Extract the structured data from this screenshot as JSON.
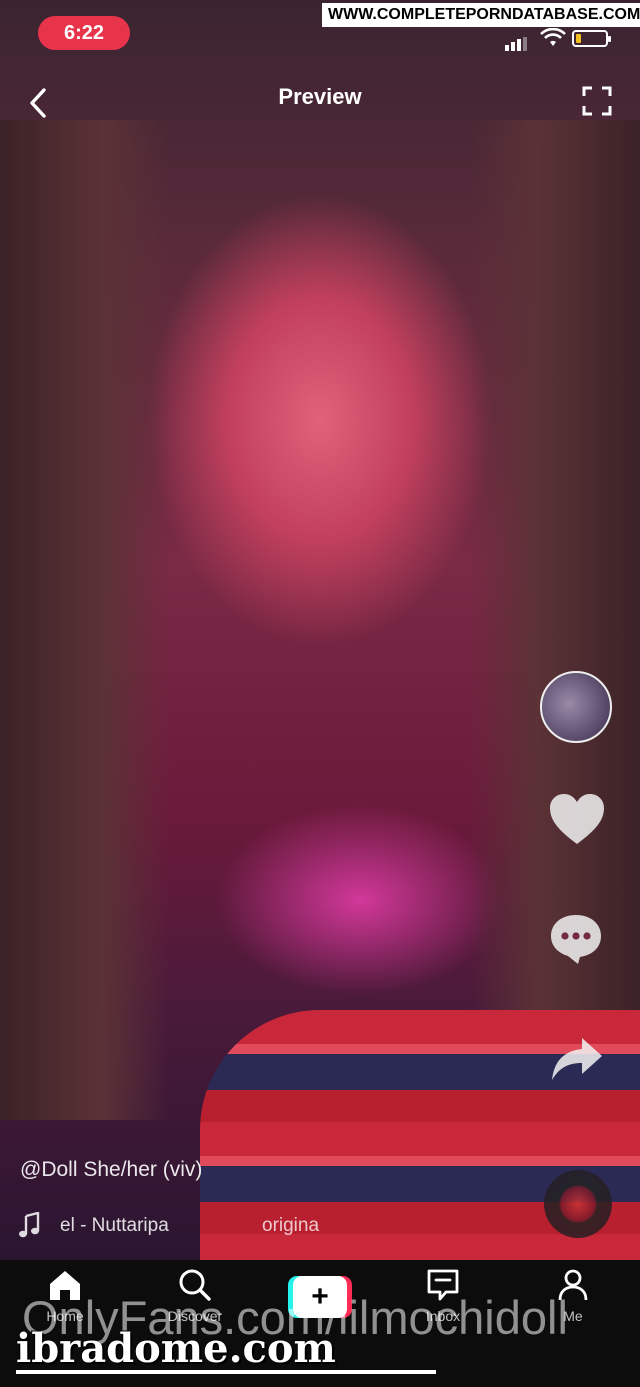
{
  "status_bar": {
    "time": "6:22",
    "battery_color": "#f0c020",
    "time_pill_color": "#e8344a"
  },
  "watermarks": {
    "top": "WWW.COMPLETEPORNDATABASE.COM",
    "middle": "OnlyFans.com/lilmochidoll",
    "bottom": "ibradome.com"
  },
  "header": {
    "title": "Preview",
    "back_icon": "chevron-left-icon",
    "fullscreen_icon": "fullscreen-icon"
  },
  "video": {
    "username": "@Doll She/her (viv)",
    "music_text": "el - Nuttaripa",
    "music_original": "origina"
  },
  "right_rail": {
    "icons": [
      "avatar",
      "heart-icon",
      "comment-icon",
      "share-icon",
      "music-disc"
    ]
  },
  "nav": {
    "items": [
      {
        "label": "Home",
        "icon": "home-icon"
      },
      {
        "label": "Discover",
        "icon": "search-icon"
      },
      {
        "label": "+",
        "icon": "create-icon"
      },
      {
        "label": "Inbox",
        "icon": "inbox-icon"
      },
      {
        "label": "Me",
        "icon": "profile-icon"
      }
    ],
    "accent_cyan": "#25f4ee",
    "accent_red": "#fe2c55"
  }
}
